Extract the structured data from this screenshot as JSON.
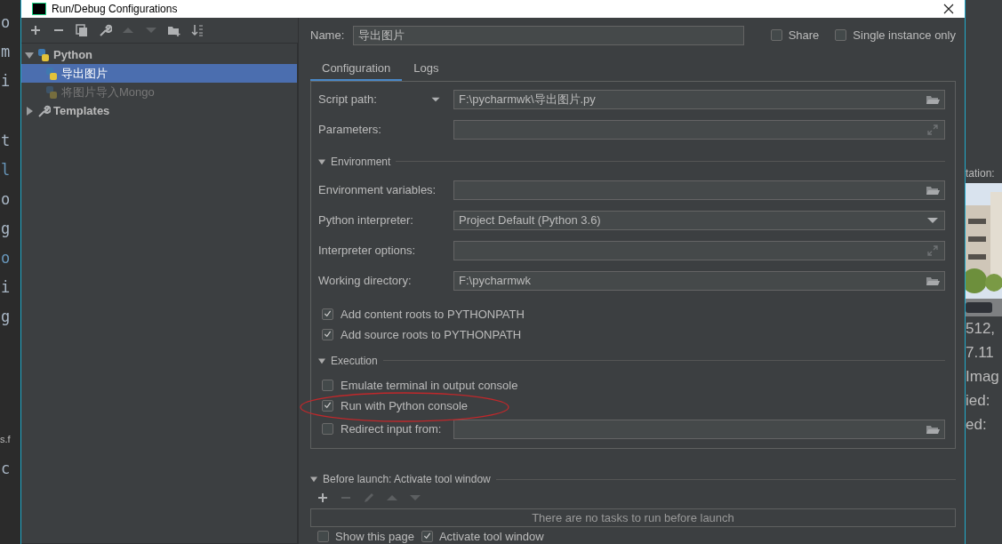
{
  "window": {
    "title": "Run/Debug Configurations"
  },
  "editor_fragments": [
    "o",
    "m",
    "i",
    "t",
    "l",
    "o",
    "g",
    "o",
    "i",
    "g",
    "s.f",
    "c"
  ],
  "toolbar": [
    {
      "kind": "add",
      "disabled": false
    },
    {
      "kind": "remove",
      "disabled": false
    },
    {
      "kind": "copy",
      "disabled": false
    },
    {
      "kind": "wrench",
      "disabled": false
    },
    {
      "kind": "up",
      "disabled": true
    },
    {
      "kind": "down",
      "disabled": true
    },
    {
      "kind": "folder",
      "disabled": false
    },
    {
      "kind": "sort",
      "disabled": false
    }
  ],
  "tree": [
    {
      "label": "Python",
      "kind": "python",
      "expanded": true,
      "selected": false,
      "disabled": false,
      "children": [
        {
          "label": "导出图片",
          "kind": "python",
          "selected": true,
          "disabled": false
        },
        {
          "label": "将图片导入Mongo",
          "kind": "python",
          "selected": false,
          "disabled": true
        }
      ]
    },
    {
      "label": "Templates",
      "kind": "templates",
      "expanded": false,
      "selected": false,
      "disabled": false
    }
  ],
  "name": {
    "label": "Name:",
    "value": "导出图片"
  },
  "options": [
    {
      "label": "Share",
      "checked": false
    },
    {
      "label": "Single instance only",
      "checked": false
    }
  ],
  "tabs": [
    {
      "label": "Configuration",
      "selected": true
    },
    {
      "label": "Logs",
      "selected": false
    }
  ],
  "form": [
    {
      "kind": "field",
      "label": "Script path:",
      "label_menu": true,
      "value": "F:\\pycharmwk\\导出图片.py",
      "folder_button": true
    },
    {
      "kind": "field",
      "label": "Parameters:",
      "expand_button": true
    },
    {
      "kind": "section",
      "label": "Environment",
      "expanded": true
    },
    {
      "kind": "field",
      "label": "Environment variables:",
      "folder_button": true
    },
    {
      "kind": "select",
      "label": "Python interpreter:",
      "value": "Project Default (Python 3.6)"
    },
    {
      "kind": "field",
      "label": "Interpreter options:",
      "expand_button": true
    },
    {
      "kind": "field",
      "label": "Working directory:",
      "value": "F:\\pycharmwk",
      "folder_button": true
    },
    {
      "kind": "checkbox",
      "label": "Add content roots to PYTHONPATH",
      "checked": true
    },
    {
      "kind": "checkbox",
      "label": "Add source roots to PYTHONPATH",
      "checked": true
    },
    {
      "kind": "section",
      "label": "Execution",
      "expanded": true
    },
    {
      "kind": "checkbox",
      "label": "Emulate terminal in output console",
      "checked": false
    },
    {
      "kind": "checkbox",
      "label": "Run with Python console",
      "checked": true,
      "circled": true
    },
    {
      "kind": "checkbox_field",
      "label": "Redirect input from:",
      "checked": false,
      "folder_button": true
    }
  ],
  "before_launch": {
    "title": "Before launch: Activate tool window",
    "expanded": true,
    "toolbar": [
      {
        "kind": "add",
        "disabled": false
      },
      {
        "kind": "remove",
        "disabled": true
      },
      {
        "kind": "edit",
        "disabled": true
      },
      {
        "kind": "up",
        "disabled": true
      },
      {
        "kind": "down",
        "disabled": true
      }
    ],
    "empty_text": "There are no tasks to run before launch"
  },
  "footer_options": [
    {
      "label": "Show this page",
      "checked": false
    },
    {
      "label": "Activate tool window",
      "checked": true
    }
  ],
  "background_window": {
    "texts": [
      "tation:",
      "512,",
      "7.11",
      "Imag",
      "ied:",
      "ed:"
    ]
  }
}
